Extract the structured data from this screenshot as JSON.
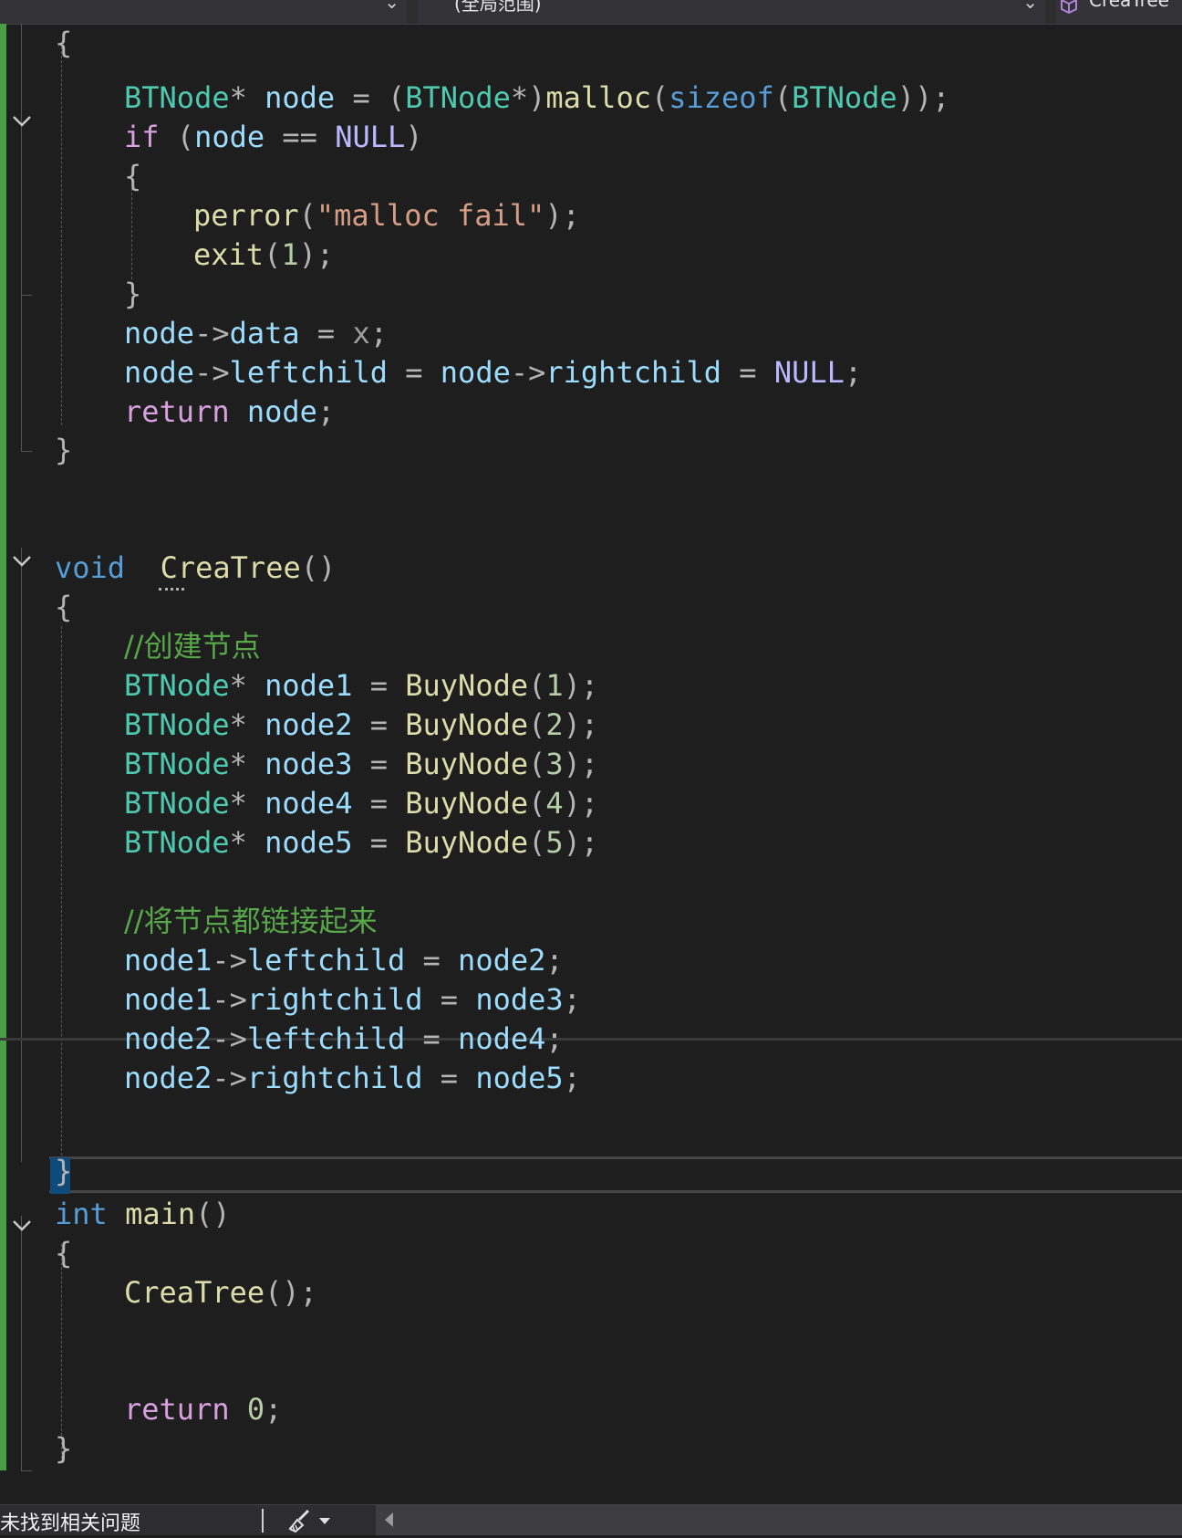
{
  "navbar": {
    "scope": "(全局范围)",
    "member": "CreaTree"
  },
  "code": {
    "l01": "{",
    "l02": [
      "BTNode",
      "*",
      " node",
      " = (",
      "BTNode",
      "*)",
      "malloc",
      "(",
      "sizeof",
      "(",
      "BTNode",
      "));"
    ],
    "l03": [
      "if",
      " (",
      "node",
      " == ",
      "NULL",
      ")"
    ],
    "l04": "{",
    "l05": [
      "perror",
      "(",
      "\"malloc fail\"",
      ");"
    ],
    "l06": [
      "exit",
      "(",
      "1",
      ");"
    ],
    "l07": "}",
    "l08": [
      "node",
      "->",
      "data",
      " = ",
      "x",
      ";"
    ],
    "l09": [
      "node",
      "->",
      "leftchild",
      " = ",
      "node",
      "->",
      "rightchild",
      " = ",
      "NULL",
      ";"
    ],
    "l10": [
      "return",
      " ",
      "node",
      ";"
    ],
    "l11": "}",
    "l14": [
      "void",
      "  ",
      "CreaTree",
      "()"
    ],
    "l15": "{",
    "l16": "//创建节点",
    "nodes": [
      {
        "type": "BTNode",
        "star": "*",
        "name": " node1",
        "eq": " = ",
        "fn": "BuyNode",
        "open": "(",
        "num": "1",
        "close": ");"
      },
      {
        "type": "BTNode",
        "star": "*",
        "name": " node2",
        "eq": " = ",
        "fn": "BuyNode",
        "open": "(",
        "num": "2",
        "close": ");"
      },
      {
        "type": "BTNode",
        "star": "*",
        "name": " node3",
        "eq": " = ",
        "fn": "BuyNode",
        "open": "(",
        "num": "3",
        "close": ");"
      },
      {
        "type": "BTNode",
        "star": "*",
        "name": " node4",
        "eq": " = ",
        "fn": "BuyNode",
        "open": "(",
        "num": "4",
        "close": ");"
      },
      {
        "type": "BTNode",
        "star": "*",
        "name": " node5",
        "eq": " = ",
        "fn": "BuyNode",
        "open": "(",
        "num": "5",
        "close": ");"
      }
    ],
    "l23": "//将节点都链接起来",
    "links": [
      {
        "a": "node1",
        "arrow": "->",
        "member": "leftchild",
        "eq": " = ",
        "b": "node2",
        "semi": ";"
      },
      {
        "a": "node1",
        "arrow": "->",
        "member": "rightchild",
        "eq": " = ",
        "b": "node3",
        "semi": ";"
      },
      {
        "a": "node2",
        "arrow": "->",
        "member": "leftchild",
        "eq": " = ",
        "b": "node4",
        "semi": ";"
      },
      {
        "a": "node2",
        "arrow": "->",
        "member": "rightchild",
        "eq": " = ",
        "b": "node5",
        "semi": ";"
      }
    ],
    "l31": "}",
    "l32": [
      "int",
      " ",
      "main",
      "()"
    ],
    "l33": "{",
    "l34": [
      "CreaTree",
      "();"
    ],
    "l37": [
      "return",
      " ",
      "0",
      ";"
    ],
    "l38": "}"
  },
  "statusbar": {
    "message": "未找到相关问题",
    "icon": "brush-icon"
  },
  "icons": [
    "chevron-down-icon",
    "class-cube-icon",
    "fold-collapse-icon",
    "brush-icon",
    "scroll-left-icon"
  ]
}
